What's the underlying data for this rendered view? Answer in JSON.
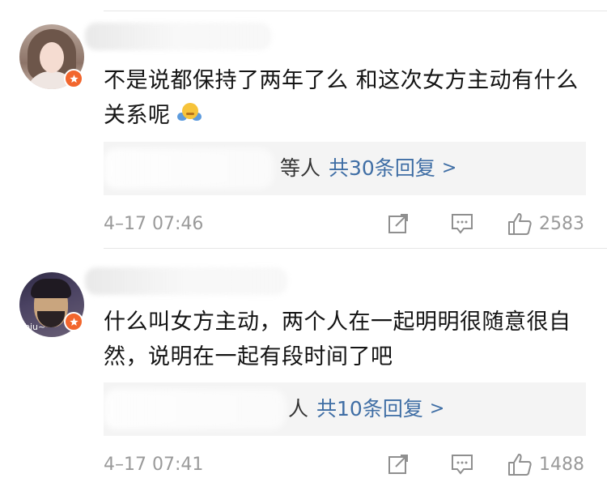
{
  "comments": [
    {
      "text": "不是说都保持了两年了么  和这次女方主动有什么关系呢",
      "replies_prefix": "等人",
      "replies_count": "共30条回复",
      "replies_arrow": ">",
      "timestamp": "4–17 07:46",
      "likes": "2583"
    },
    {
      "avatar_tag": "biu~",
      "text": "什么叫女方主动，两个人在一起明明很随意很自然，说明在一起有段时间了吧",
      "replies_prefix": "人",
      "replies_count": "共10条回复",
      "replies_arrow": ">",
      "timestamp": "4–17 07:41",
      "likes": "1488"
    }
  ],
  "colors": {
    "link_blue": "#3f6ea5",
    "badge_orange": "#f2662d",
    "meta_gray": "#9a9a9a",
    "reply_bg": "#f4f4f4"
  },
  "icons": [
    "verified-badge-icon",
    "shrug-emoji-icon",
    "repost-icon",
    "comment-icon",
    "like-icon"
  ]
}
